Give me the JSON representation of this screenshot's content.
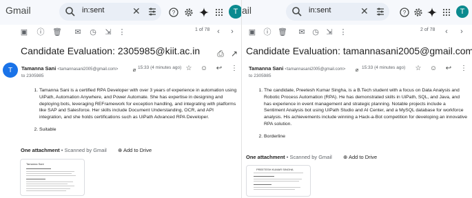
{
  "left": {
    "app_name": "Gmail",
    "search": {
      "value": "in:sent"
    },
    "avatar_letter": "T",
    "pagination": "1 of 78",
    "subject": "Candidate Evaluation: 2305985@kiit.ac.in",
    "sender_initial": "T",
    "sender_name": "Tamanna Sani",
    "sender_email": "<tamannasani2005@gmail.com>",
    "to": "to 2305985",
    "time": "15:33 (4 minutes ago)",
    "items": [
      "Tamanna Sani is a certified RPA Developer with over 3 years of experience in automation using UiPath, Automation Anywhere, and Power Automate. She has expertise in designing and deploying bots, leveraging REFramework for exception handling, and integrating with platforms like SAP and Salesforce. Her skills include Document Understanding, OCR, and API integration, and she holds certifications such as UiPath Advanced RPA Developer.",
      "Suitable"
    ],
    "attachment_count": "One attachment",
    "scanned": "Scanned by Gmail",
    "add_to_drive": "Add to Drive",
    "thumb_title": "Tamanna Sani"
  },
  "right": {
    "app_name": "ail",
    "search": {
      "value": "in:sent"
    },
    "avatar_letter": "T",
    "pagination": "2 of 78",
    "subject": "Candidate Evaluation: tamannasani2005@gmail.com",
    "sender_initial": "T",
    "sender_name": "Tamanna Sani",
    "sender_email": "<tamannasani2005@gmail.com>",
    "to": "to 2305985",
    "time": "15:33 (4 minutes ago)",
    "items": [
      "The candidate, Preetesh Kumar Singha, is a B.Tech student with a focus on Data Analysis and Robotic Process Automation (RPA). He has demonstrated skills in UiPath, SQL, and Java, and has experience in event management and strategic planning. Notable projects include a Sentiment Analysis bot using UiPath Studio and AI Center, and a MySQL database for workforce analysis. His achievements include winning a Hack-a-Bot competition for developing an innovative RPA solution.",
      "Borderline"
    ],
    "attachment_count": "One attachment",
    "scanned": "Scanned by Gmail",
    "add_to_drive": "Add to Drive",
    "thumb_title": "PREETESH KUMAR SINGHA"
  },
  "colors": {
    "avatar": "#0b8a8f",
    "sender_avatar": "#1a73e8",
    "topbar": "#f6f8fc",
    "search": "#e9eef6"
  }
}
